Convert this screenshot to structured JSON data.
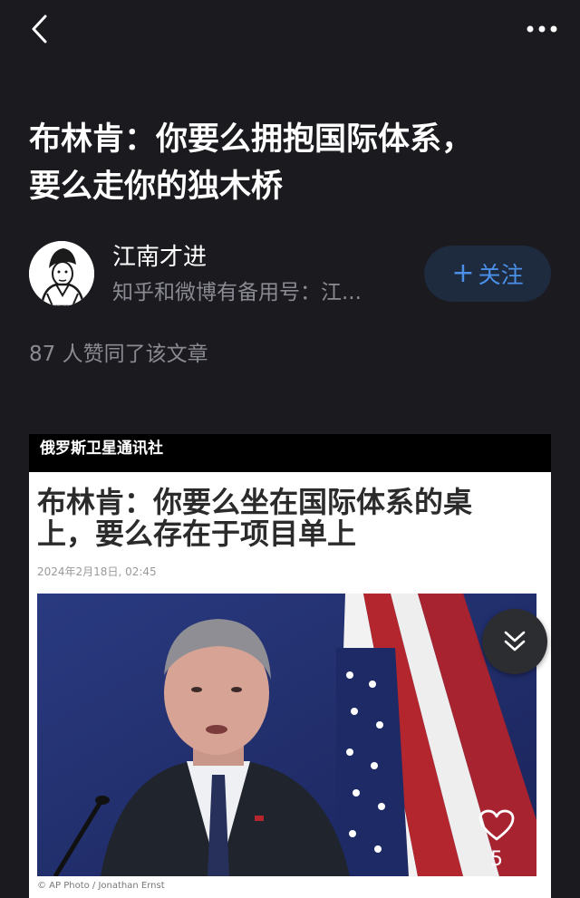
{
  "topbar": {
    "back_icon": "chevron-left-icon",
    "more_icon": "more-horizontal-icon"
  },
  "article": {
    "title_line1": "布林肯：你要么拥抱国际体系，",
    "title_line2": "要么走你的独木桥",
    "likes_text": "87 人赞同了该文章"
  },
  "author": {
    "name": "江南才进",
    "bio": "知乎和微博有备用号：江...",
    "follow_label": "关注",
    "follow_plus": "+"
  },
  "embed": {
    "source": "俄罗斯卫星通讯社",
    "title_line1": "布林肯：你要么坐在国际体系的桌",
    "title_line2": "上，要么存在于项目单上",
    "date": "2024年2月18日, 02:45",
    "photo_credit": "© AP Photo / Jonathan Ernst"
  },
  "floating": {
    "scroll_icon": "double-chevron-down-icon",
    "like_icon": "heart-outline-icon",
    "like_count": "5"
  },
  "colors": {
    "background": "#1a1a1f",
    "accent": "#4a90e8",
    "follow_bg": "#1e2a3d",
    "muted_text": "#8a8a92"
  }
}
